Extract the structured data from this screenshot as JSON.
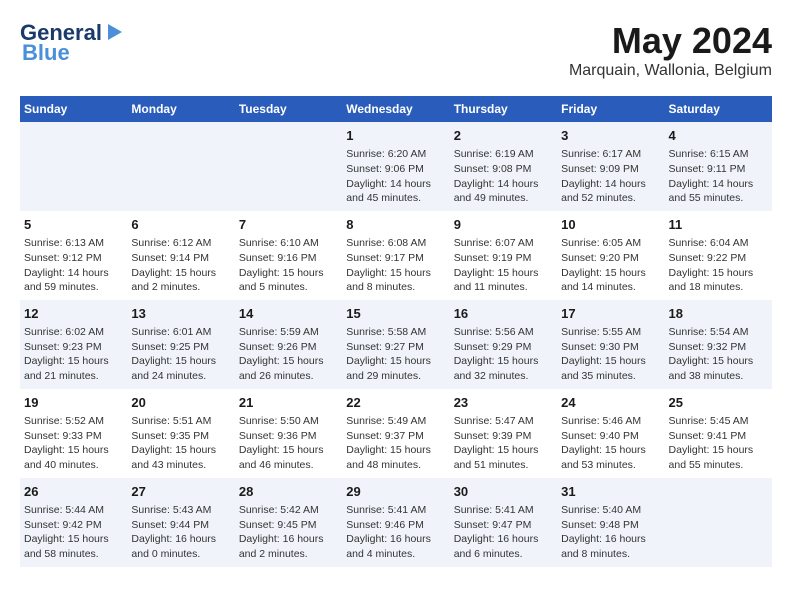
{
  "header": {
    "logo_general": "General",
    "logo_blue": "Blue",
    "month_title": "May 2024",
    "location": "Marquain, Wallonia, Belgium"
  },
  "weekdays": [
    "Sunday",
    "Monday",
    "Tuesday",
    "Wednesday",
    "Thursday",
    "Friday",
    "Saturday"
  ],
  "weeks": [
    [
      {
        "day": "",
        "info": ""
      },
      {
        "day": "",
        "info": ""
      },
      {
        "day": "",
        "info": ""
      },
      {
        "day": "1",
        "info": "Sunrise: 6:20 AM\nSunset: 9:06 PM\nDaylight: 14 hours\nand 45 minutes."
      },
      {
        "day": "2",
        "info": "Sunrise: 6:19 AM\nSunset: 9:08 PM\nDaylight: 14 hours\nand 49 minutes."
      },
      {
        "day": "3",
        "info": "Sunrise: 6:17 AM\nSunset: 9:09 PM\nDaylight: 14 hours\nand 52 minutes."
      },
      {
        "day": "4",
        "info": "Sunrise: 6:15 AM\nSunset: 9:11 PM\nDaylight: 14 hours\nand 55 minutes."
      }
    ],
    [
      {
        "day": "5",
        "info": "Sunrise: 6:13 AM\nSunset: 9:12 PM\nDaylight: 14 hours\nand 59 minutes."
      },
      {
        "day": "6",
        "info": "Sunrise: 6:12 AM\nSunset: 9:14 PM\nDaylight: 15 hours\nand 2 minutes."
      },
      {
        "day": "7",
        "info": "Sunrise: 6:10 AM\nSunset: 9:16 PM\nDaylight: 15 hours\nand 5 minutes."
      },
      {
        "day": "8",
        "info": "Sunrise: 6:08 AM\nSunset: 9:17 PM\nDaylight: 15 hours\nand 8 minutes."
      },
      {
        "day": "9",
        "info": "Sunrise: 6:07 AM\nSunset: 9:19 PM\nDaylight: 15 hours\nand 11 minutes."
      },
      {
        "day": "10",
        "info": "Sunrise: 6:05 AM\nSunset: 9:20 PM\nDaylight: 15 hours\nand 14 minutes."
      },
      {
        "day": "11",
        "info": "Sunrise: 6:04 AM\nSunset: 9:22 PM\nDaylight: 15 hours\nand 18 minutes."
      }
    ],
    [
      {
        "day": "12",
        "info": "Sunrise: 6:02 AM\nSunset: 9:23 PM\nDaylight: 15 hours\nand 21 minutes."
      },
      {
        "day": "13",
        "info": "Sunrise: 6:01 AM\nSunset: 9:25 PM\nDaylight: 15 hours\nand 24 minutes."
      },
      {
        "day": "14",
        "info": "Sunrise: 5:59 AM\nSunset: 9:26 PM\nDaylight: 15 hours\nand 26 minutes."
      },
      {
        "day": "15",
        "info": "Sunrise: 5:58 AM\nSunset: 9:27 PM\nDaylight: 15 hours\nand 29 minutes."
      },
      {
        "day": "16",
        "info": "Sunrise: 5:56 AM\nSunset: 9:29 PM\nDaylight: 15 hours\nand 32 minutes."
      },
      {
        "day": "17",
        "info": "Sunrise: 5:55 AM\nSunset: 9:30 PM\nDaylight: 15 hours\nand 35 minutes."
      },
      {
        "day": "18",
        "info": "Sunrise: 5:54 AM\nSunset: 9:32 PM\nDaylight: 15 hours\nand 38 minutes."
      }
    ],
    [
      {
        "day": "19",
        "info": "Sunrise: 5:52 AM\nSunset: 9:33 PM\nDaylight: 15 hours\nand 40 minutes."
      },
      {
        "day": "20",
        "info": "Sunrise: 5:51 AM\nSunset: 9:35 PM\nDaylight: 15 hours\nand 43 minutes."
      },
      {
        "day": "21",
        "info": "Sunrise: 5:50 AM\nSunset: 9:36 PM\nDaylight: 15 hours\nand 46 minutes."
      },
      {
        "day": "22",
        "info": "Sunrise: 5:49 AM\nSunset: 9:37 PM\nDaylight: 15 hours\nand 48 minutes."
      },
      {
        "day": "23",
        "info": "Sunrise: 5:47 AM\nSunset: 9:39 PM\nDaylight: 15 hours\nand 51 minutes."
      },
      {
        "day": "24",
        "info": "Sunrise: 5:46 AM\nSunset: 9:40 PM\nDaylight: 15 hours\nand 53 minutes."
      },
      {
        "day": "25",
        "info": "Sunrise: 5:45 AM\nSunset: 9:41 PM\nDaylight: 15 hours\nand 55 minutes."
      }
    ],
    [
      {
        "day": "26",
        "info": "Sunrise: 5:44 AM\nSunset: 9:42 PM\nDaylight: 15 hours\nand 58 minutes."
      },
      {
        "day": "27",
        "info": "Sunrise: 5:43 AM\nSunset: 9:44 PM\nDaylight: 16 hours\nand 0 minutes."
      },
      {
        "day": "28",
        "info": "Sunrise: 5:42 AM\nSunset: 9:45 PM\nDaylight: 16 hours\nand 2 minutes."
      },
      {
        "day": "29",
        "info": "Sunrise: 5:41 AM\nSunset: 9:46 PM\nDaylight: 16 hours\nand 4 minutes."
      },
      {
        "day": "30",
        "info": "Sunrise: 5:41 AM\nSunset: 9:47 PM\nDaylight: 16 hours\nand 6 minutes."
      },
      {
        "day": "31",
        "info": "Sunrise: 5:40 AM\nSunset: 9:48 PM\nDaylight: 16 hours\nand 8 minutes."
      },
      {
        "day": "",
        "info": ""
      }
    ]
  ]
}
